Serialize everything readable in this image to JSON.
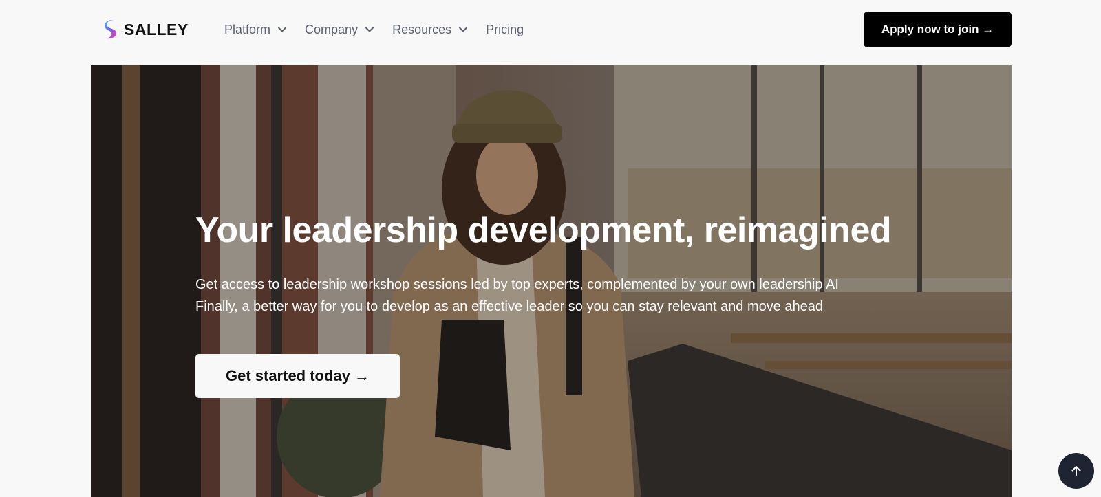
{
  "brand": {
    "name": "SALLEY",
    "logo_icon": "salley-logo-mark"
  },
  "nav": {
    "items": [
      {
        "label": "Platform",
        "has_dropdown": true,
        "icon": "chevron-down-icon"
      },
      {
        "label": "Company",
        "has_dropdown": true,
        "icon": "chevron-down-icon"
      },
      {
        "label": "Resources",
        "has_dropdown": true,
        "icon": "chevron-down-icon"
      },
      {
        "label": "Pricing",
        "has_dropdown": false
      }
    ],
    "cta_label": "Apply now to join →"
  },
  "hero": {
    "title": "Your leadership development, reimagined",
    "subtitle_line1": "Get access to leadership workshop sessions led by top experts, complemented by your own leadership AI",
    "subtitle_line2": "Finally, a better way for you to develop as an effective leader so you can stay relevant and move ahead",
    "cta_label": "Get started today →",
    "image": "photo-woman-with-beanie-holding-laptop"
  },
  "scroll_top": {
    "icon": "arrow-up-icon"
  },
  "colors": {
    "background": "#f8f8f8",
    "nav_text": "#5b6070",
    "primary_button": "#000000",
    "scroll_button": "#1f2433",
    "logo_gradient": [
      "#2fb8f0",
      "#7a5cf0",
      "#ff3fa0"
    ]
  }
}
